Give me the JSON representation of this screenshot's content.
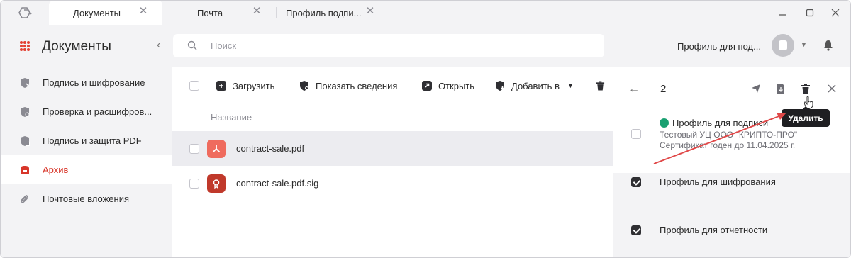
{
  "tabs": [
    {
      "label": "Документы"
    },
    {
      "label": "Почта"
    },
    {
      "label": "Профиль подпи..."
    }
  ],
  "sidebar": {
    "title": "Документы",
    "items": [
      {
        "label": "Подпись и шифрование",
        "icon": "shield-pen-icon"
      },
      {
        "label": "Проверка и расшифров...",
        "icon": "shield-check-icon"
      },
      {
        "label": "Подпись и защита PDF",
        "icon": "shield-pdf-icon"
      },
      {
        "label": "Архив",
        "icon": "archive-icon"
      },
      {
        "label": "Почтовые вложения",
        "icon": "paperclip-icon"
      }
    ]
  },
  "search": {
    "placeholder": "Поиск"
  },
  "header": {
    "profile_name": "Профиль для под..."
  },
  "toolbar": {
    "upload": "Загрузить",
    "show_info": "Показать сведения",
    "open": "Открыть",
    "add_to": "Добавить в"
  },
  "table": {
    "column": "Название",
    "rows": [
      {
        "name": "contract-sale.pdf",
        "icon": "pdf-file-icon"
      },
      {
        "name": "contract-sale.pdf.sig",
        "icon": "signature-file-icon"
      }
    ]
  },
  "details": {
    "count": "2",
    "tooltip": "Удалить",
    "profiles": [
      {
        "title": "Профиль для подписи",
        "issuer": "Тестовый УЦ ООО \"КРИПТО-ПРО\"",
        "validity": "Сертификат годен до 11.04.2025 г.",
        "checked": false
      },
      {
        "title": "Профиль для шифрования",
        "checked": true
      },
      {
        "title": "Профиль для отчетности",
        "checked": true
      }
    ]
  },
  "colors": {
    "accent": "#d8362a",
    "ok": "#1aa071",
    "pdf": "#ef6b5e",
    "sig": "#c0392b",
    "arrow": "#e04848"
  }
}
